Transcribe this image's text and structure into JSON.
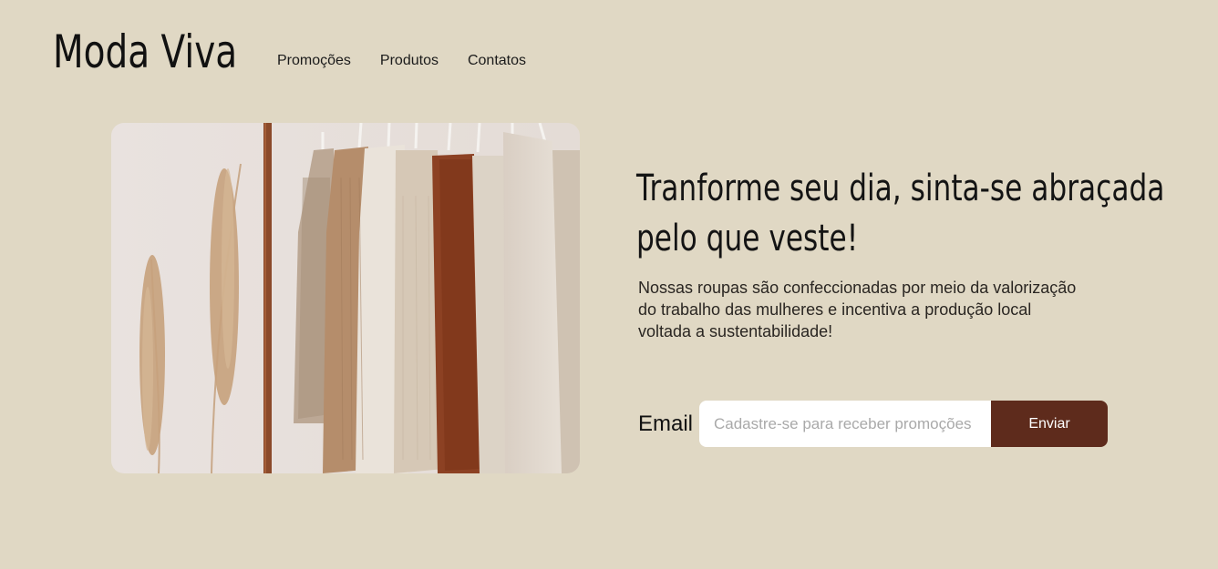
{
  "brand": {
    "logo_text": "Moda Viva"
  },
  "nav": {
    "items": [
      {
        "label": "Promoções"
      },
      {
        "label": "Produtos"
      },
      {
        "label": "Contatos"
      }
    ]
  },
  "hero": {
    "headline_lines": [
      "Tranforme seu dia, sinta-se abraçada",
      "pelo que veste!"
    ],
    "description_lines": [
      "Nossas roupas são confeccionadas por meio da valorização",
      "do trabalho das mulheres e incentiva a produção local",
      "voltada a sustentabilidade!"
    ],
    "image_icon": "clothing-rack-photo"
  },
  "signup": {
    "label": "Email",
    "placeholder": "Cadastre-se para receber promoções",
    "value": "",
    "button_label": "Enviar"
  },
  "colors": {
    "background": "#E0D8C4",
    "button": "#5E2B1C",
    "input_background": "#FFFFFF"
  }
}
